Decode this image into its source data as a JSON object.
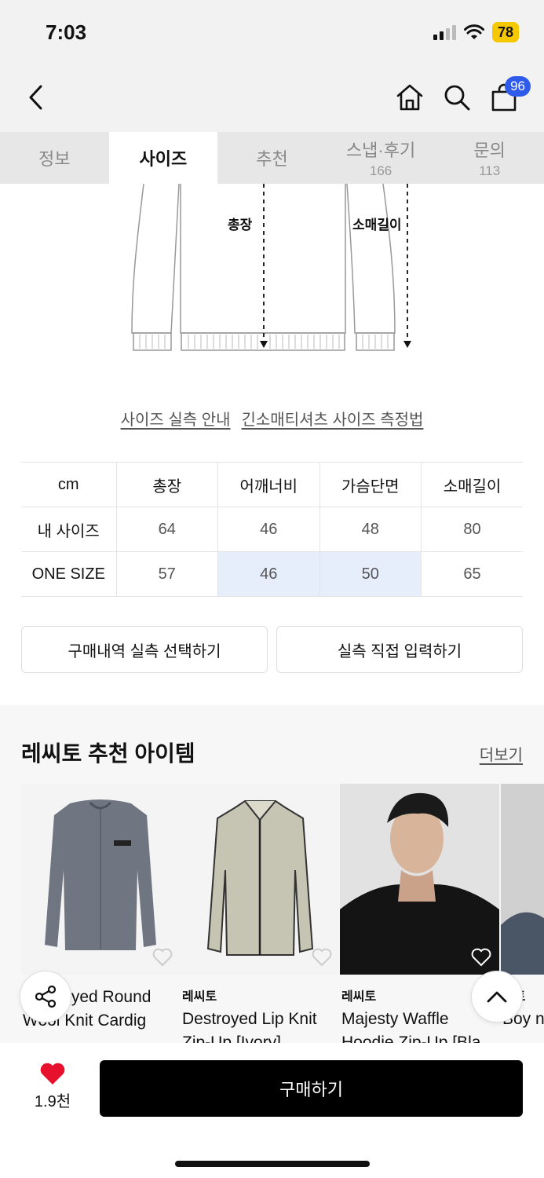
{
  "status_bar": {
    "time": "7:03",
    "battery": "78"
  },
  "header": {
    "cart_count": "96"
  },
  "tabs": [
    {
      "label": "정보",
      "count": ""
    },
    {
      "label": "사이즈",
      "count": ""
    },
    {
      "label": "추천",
      "count": ""
    },
    {
      "label": "스냅·후기",
      "count": "166"
    },
    {
      "label": "문의",
      "count": "113"
    }
  ],
  "diagram": {
    "length_label": "총장",
    "sleeve_label": "소매길이"
  },
  "size_links": [
    "사이즈 실측 안내",
    "긴소매티셔츠 사이즈 측정법"
  ],
  "size_table": {
    "headers": [
      "cm",
      "총장",
      "어깨너비",
      "가슴단면",
      "소매길이"
    ],
    "rows": [
      {
        "label": "내 사이즈",
        "values": [
          "64",
          "46",
          "48",
          "80"
        ]
      },
      {
        "label": "ONE SIZE",
        "values": [
          "57",
          "46",
          "50",
          "65"
        ]
      }
    ]
  },
  "actions": {
    "purchase_history": "구매내역 실측 선택하기",
    "direct_input": "실측 직접 입력하기"
  },
  "recommendation": {
    "title": "레씨토 추천 아이템",
    "more": "더보기",
    "products": [
      {
        "brand": "",
        "name": "Destroyed Round Wool Knit Cardig"
      },
      {
        "brand": "레씨토",
        "name": "Destroyed Lip Knit Zip-Up [Ivory]"
      },
      {
        "brand": "레씨토",
        "name": "Majesty Waffle Hoodie Zip-Up [Bla"
      },
      {
        "brand": "씨토",
        "name": "Boy ng S"
      }
    ]
  },
  "bottom": {
    "like_count": "1.9천",
    "buy_label": "구매하기"
  },
  "colors": {
    "accent": "#2f5bea",
    "highlight": "#e6eefc",
    "heart": "#e8112d",
    "battery": "#f5c800"
  }
}
